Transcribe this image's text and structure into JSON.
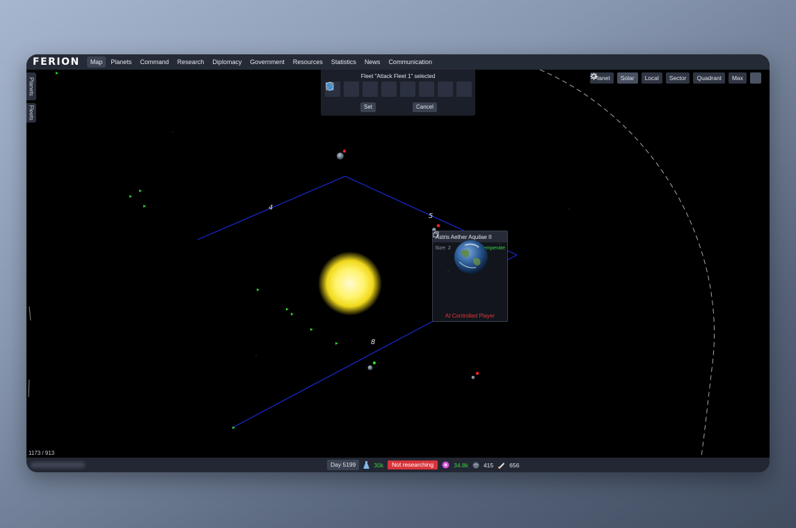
{
  "app": {
    "logo": "FERION"
  },
  "nav": [
    "Map",
    "Planets",
    "Command",
    "Research",
    "Diplomacy",
    "Government",
    "Resources",
    "Statistics",
    "News",
    "Communication"
  ],
  "side_tabs": {
    "planets": "Planets",
    "fleets": "Fleets"
  },
  "fleet_panel": {
    "title": "Fleet \"Attack Fleet 1\" selected",
    "icons": [
      "move-fleet-icon",
      "attack-icon",
      "colonize-icon",
      "join-fleet-icon",
      "split-fleet-icon",
      "explore-icon",
      "defend-shield-icon",
      "link-icon"
    ],
    "set_label": "Set",
    "cancel_label": "Cancel"
  },
  "zoom": {
    "options": [
      "Planet",
      "Solar",
      "Local",
      "Sector",
      "Quadrant",
      "Max"
    ],
    "active": "Solar"
  },
  "map": {
    "route_labels": [
      "4",
      "5",
      "8"
    ],
    "coords": "1173 / 913"
  },
  "tooltip": {
    "planet_name": "Astris Aether Aquilae II",
    "size": "Size: 2",
    "climate": "Temperate",
    "owner": "AI Controlled Player"
  },
  "status": {
    "day": "Day 5199",
    "research_points": "30k",
    "research_status": "Not researching",
    "credits": "34.8k",
    "planets": "415",
    "ships": "656"
  },
  "colors": {
    "accent_green": "#3fcf3a",
    "danger_red": "#d8343a",
    "route_blue": "#1a2ad6",
    "sun_yellow": "#fff36a"
  }
}
